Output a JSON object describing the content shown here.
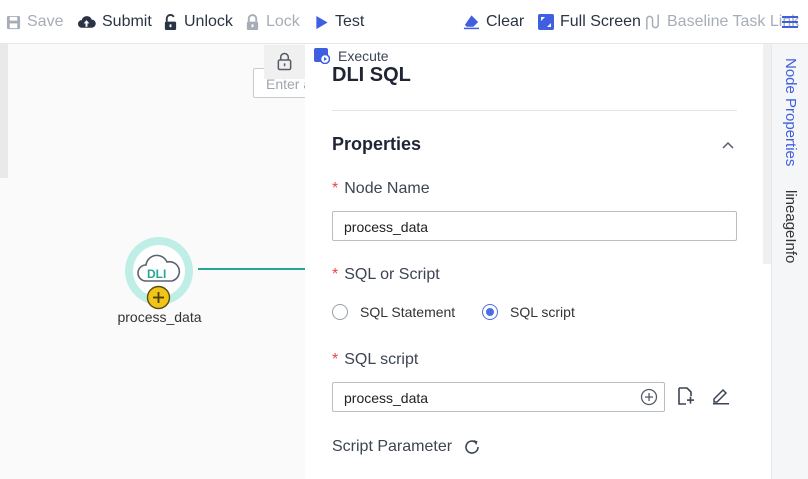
{
  "toolbar": {
    "save": "Save",
    "submit": "Submit",
    "unlock": "Unlock",
    "lock": "Lock",
    "test": "Test",
    "clear": "Clear",
    "full_screen": "Full Screen",
    "baseline": "Baseline Task Link"
  },
  "canvas": {
    "search_placeholder": "Enter a",
    "node_badge": "DLI",
    "node_label": "process_data"
  },
  "panel": {
    "execute": "Execute",
    "title": "DLI SQL",
    "section": "Properties",
    "required_mark": "*",
    "node_name_label": "Node Name",
    "node_name_value": "process_data",
    "sql_or_script_label": "SQL or Script",
    "option_statement": "SQL Statement",
    "option_script": "SQL script",
    "selected_option": "SQL script",
    "sql_script_label": "SQL script",
    "sql_script_value": "process_data",
    "script_parameter_label": "Script Parameter"
  },
  "right_tabs": {
    "node_properties": "Node Properties",
    "lineage": "lineageInfo"
  },
  "colors": {
    "accent": "#4c6fe0",
    "link_line": "#28a395",
    "required": "#e5454e",
    "disabled_text": "#a7adb7",
    "node_plus": "#f0c419"
  }
}
